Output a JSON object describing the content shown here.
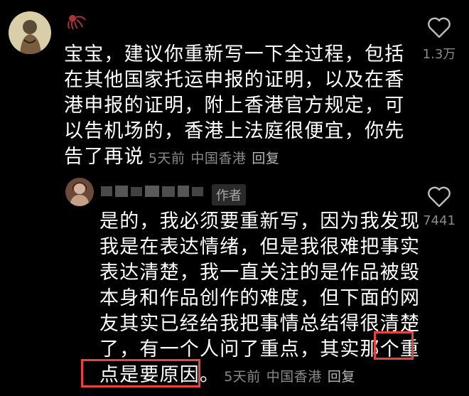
{
  "comments": [
    {
      "lines": [
        "宝宝，建议你重新写一下全过程，包括",
        "在其他国家托运申报的证明，以及在香",
        "港申报的证明，附上香港官方规定，可",
        "以告机场的，香港上法庭很便宜，你先",
        "告了再说"
      ],
      "time": "5天前",
      "location": "中国香港",
      "reply": "回复",
      "likes": "1.3万"
    },
    {
      "author_tag": "作者",
      "lines": [
        "是的，我必须要重新写，因为我发现",
        "我是在表达情绪，但是我很难把事实",
        "表达清楚，我一直关注的是作品被毁",
        "本身和作品创作的难度，但下面的网",
        "友其实已经给我把事情总结得很清楚",
        "了，有一个人问了重点，其实那个重",
        "点是要原因。"
      ],
      "time": "5天前",
      "location": "中国香港",
      "reply": "回复",
      "likes": "7441"
    }
  ],
  "colors": {
    "background": "#000000",
    "text": "#ffffff",
    "meta": "#8a8a8a",
    "highlight_box": "#e8443f"
  },
  "icons": {
    "like": "heart-outline-icon",
    "username": "octopus-glyph-icon"
  }
}
